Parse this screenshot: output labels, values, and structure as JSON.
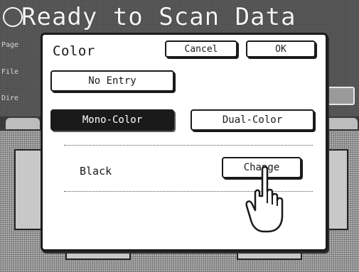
{
  "background": {
    "title": "Ready to Scan Data",
    "labels": [
      "Page",
      "File",
      "Dire"
    ]
  },
  "dialog": {
    "title": "Color",
    "cancel_label": "Cancel",
    "ok_label": "OK",
    "no_entry_label": "No Entry",
    "mono_color_label": "Mono-Color",
    "dual_color_label": "Dual-Color",
    "selected_mode": "Mono-Color",
    "current_color": "Black",
    "change_label": "Change"
  },
  "colors": {
    "panel": "#ffffff",
    "ink": "#1a1a1a",
    "background_dither": "#9a9a9a"
  },
  "icons": {
    "pointer": "hand-pointer-icon"
  }
}
